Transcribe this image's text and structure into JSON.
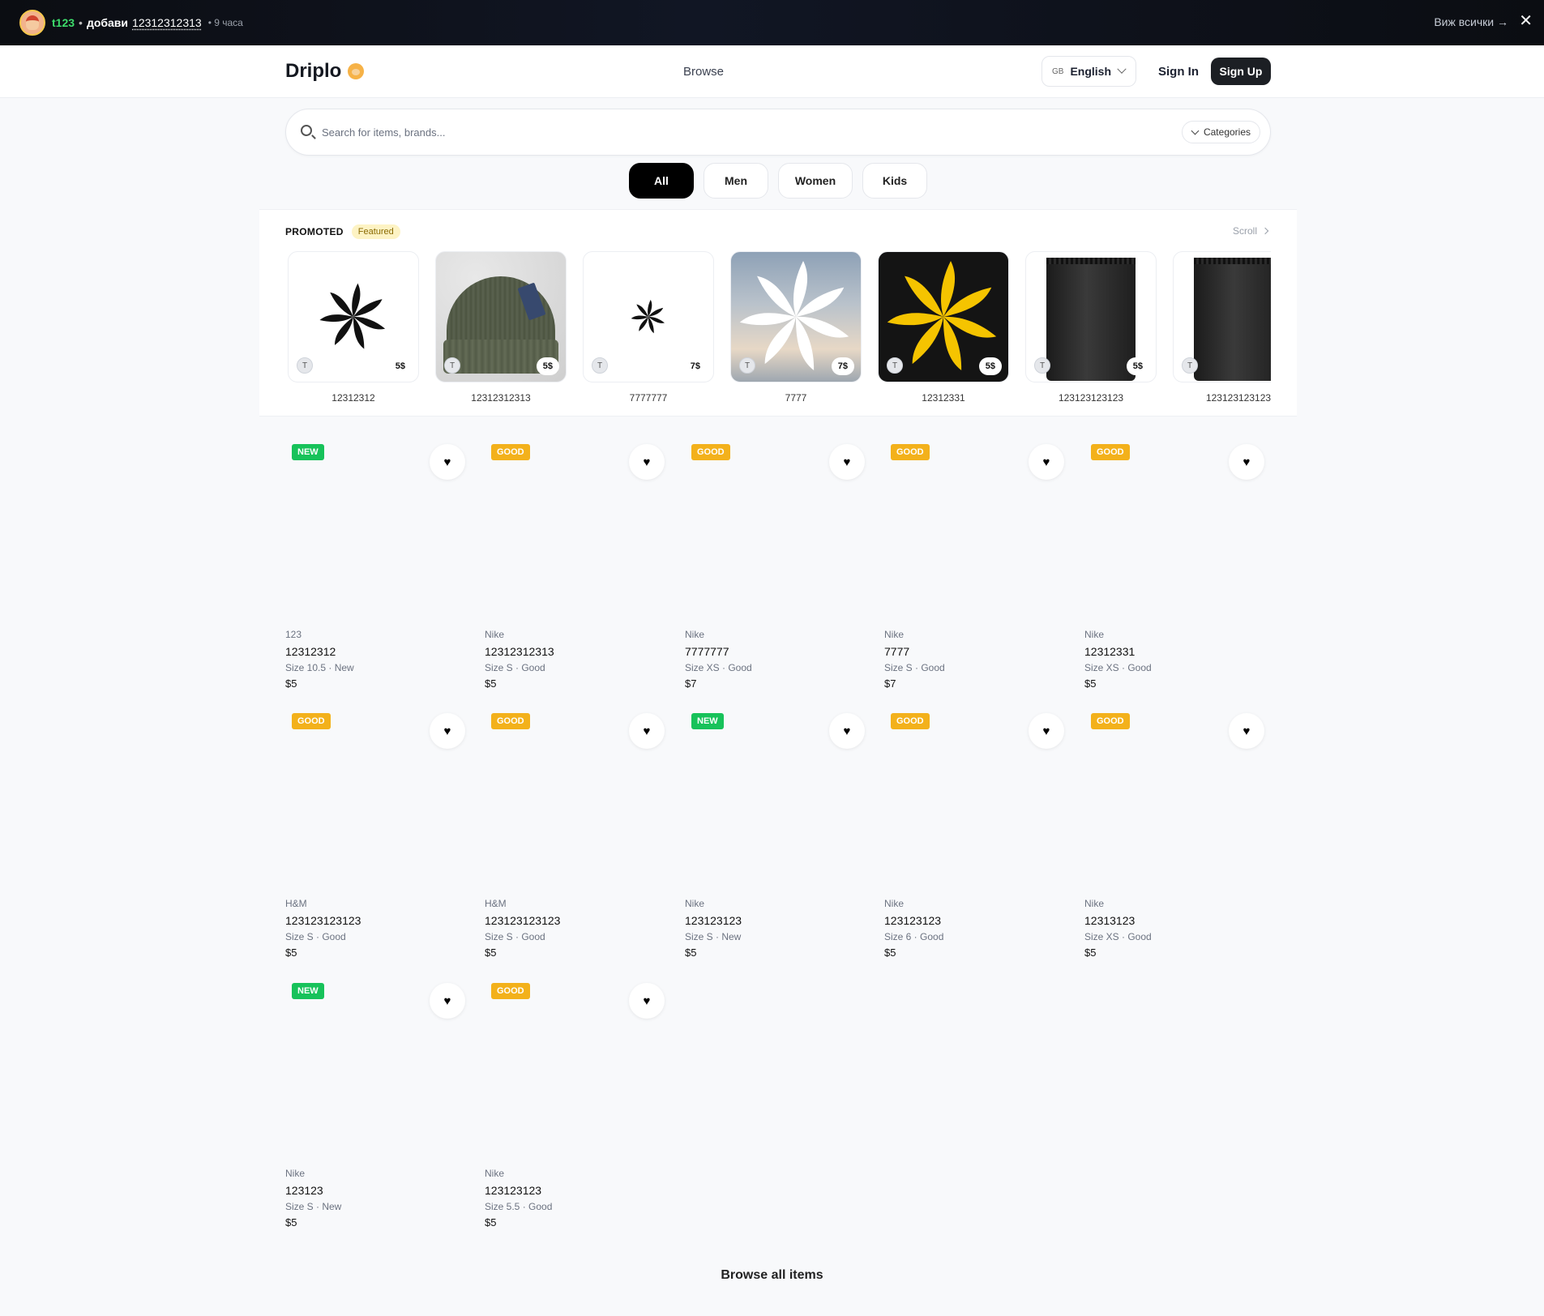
{
  "notification": {
    "user": "t123",
    "separator": "•",
    "action": "добави",
    "item": "12312312313",
    "time": "• 9 часа",
    "view_all": "Виж всички →",
    "close": "✕"
  },
  "header": {
    "logo": "Driplo",
    "browse": "Browse",
    "language_flag": "GB",
    "language": "English",
    "sign_in": "Sign In",
    "sign_up": "Sign Up"
  },
  "search": {
    "placeholder": "Search for items, brands...",
    "categories": "Categories"
  },
  "tabs": [
    {
      "label": "All",
      "active": true
    },
    {
      "label": "Men",
      "active": false
    },
    {
      "label": "Women",
      "active": false
    },
    {
      "label": "Kids",
      "active": false
    }
  ],
  "promoted": {
    "title": "PROMOTED",
    "badge": "Featured",
    "scroll": "Scroll",
    "items": [
      {
        "name": "12312312",
        "price": "5$",
        "seller": "T",
        "image": "star-black"
      },
      {
        "name": "12312312313",
        "price": "5$",
        "seller": "T",
        "image": "beanie"
      },
      {
        "name": "7777777",
        "price": "7$",
        "seller": "T",
        "image": "star-small"
      },
      {
        "name": "7777",
        "price": "7$",
        "seller": "T",
        "image": "star-white-sky"
      },
      {
        "name": "12312331",
        "price": "5$",
        "seller": "T",
        "image": "star-yellow"
      },
      {
        "name": "123123123123",
        "price": "5$",
        "seller": "T",
        "image": "black-bag"
      },
      {
        "name": "123123123123",
        "price": "",
        "seller": "T",
        "image": "black-bag"
      }
    ]
  },
  "products": [
    {
      "badge": "NEW",
      "brand": "123",
      "title": "12312312",
      "meta": "Size 10.5 · New",
      "price": "$5"
    },
    {
      "badge": "GOOD",
      "brand": "Nike",
      "title": "12312312313",
      "meta": "Size S · Good",
      "price": "$5"
    },
    {
      "badge": "GOOD",
      "brand": "Nike",
      "title": "7777777",
      "meta": "Size XS · Good",
      "price": "$7"
    },
    {
      "badge": "GOOD",
      "brand": "Nike",
      "title": "7777",
      "meta": "Size S · Good",
      "price": "$7"
    },
    {
      "badge": "GOOD",
      "brand": "Nike",
      "title": "12312331",
      "meta": "Size XS · Good",
      "price": "$5"
    },
    {
      "badge": "GOOD",
      "brand": "H&M",
      "title": "123123123123",
      "meta": "Size S · Good",
      "price": "$5"
    },
    {
      "badge": "GOOD",
      "brand": "H&M",
      "title": "123123123123",
      "meta": "Size S · Good",
      "price": "$5"
    },
    {
      "badge": "NEW",
      "brand": "Nike",
      "title": "123123123",
      "meta": "Size S · New",
      "price": "$5"
    },
    {
      "badge": "GOOD",
      "brand": "Nike",
      "title": "123123123",
      "meta": "Size 6 · Good",
      "price": "$5"
    },
    {
      "badge": "GOOD",
      "brand": "Nike",
      "title": "12313123",
      "meta": "Size XS · Good",
      "price": "$5"
    },
    {
      "badge": "NEW",
      "brand": "Nike",
      "title": "123123",
      "meta": "Size S · New",
      "price": "$5"
    },
    {
      "badge": "GOOD",
      "brand": "Nike",
      "title": "123123123",
      "meta": "Size 5.5 · Good",
      "price": "$5"
    }
  ],
  "browse_all": "Browse all items",
  "colors": {
    "badge_new": "#17c25a",
    "badge_good": "#f3b11b",
    "username": "#3ddc6b",
    "primary_button": "#1c1f24"
  }
}
